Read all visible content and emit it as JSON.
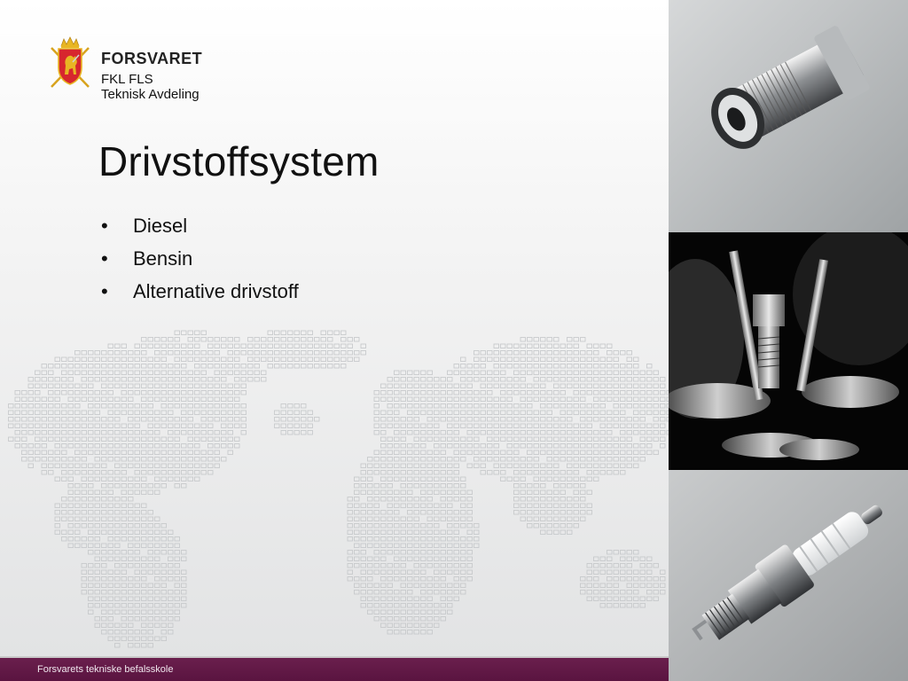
{
  "header": {
    "brand": "FORSVARET",
    "unit": "FKL FLS",
    "department": "Teknisk Avdeling",
    "crest_icon": "norwegian-lion-crest-icon"
  },
  "slide": {
    "title": "Drivstoffsystem",
    "bullets": [
      {
        "marker": "•",
        "text": "Diesel"
      },
      {
        "marker": "•",
        "text": "Bensin"
      },
      {
        "marker": "•",
        "text": "Alternative drivstoff"
      }
    ]
  },
  "photos": [
    {
      "name": "injector-nozzle-photo"
    },
    {
      "name": "engine-valves-spark-plug-photo"
    },
    {
      "name": "spark-plug-photo"
    }
  ],
  "footer": {
    "text": "Forsvarets tekniske befalsskole"
  },
  "colors": {
    "footer_bar": "#5e1744",
    "crest_red": "#d7262e",
    "crest_gold": "#e8b623",
    "title_text": "#111111"
  }
}
